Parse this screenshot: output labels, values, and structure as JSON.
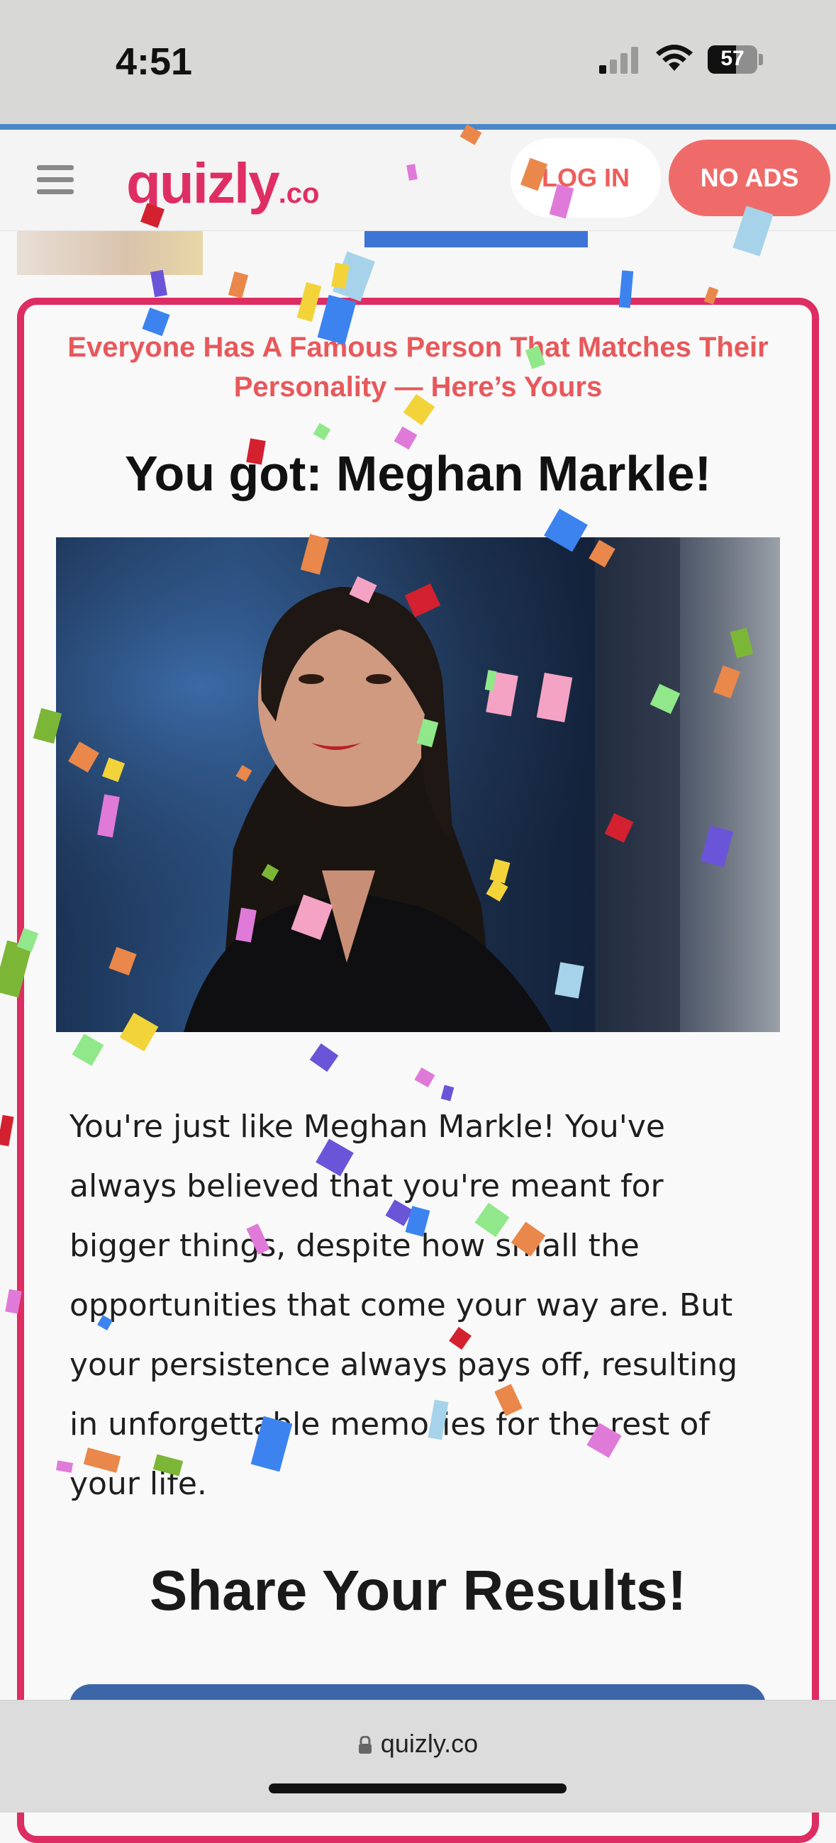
{
  "status_bar": {
    "time": "4:51",
    "battery": "57",
    "battery_level": 0.57
  },
  "header": {
    "logo_main": "quizly",
    "logo_tld": ".co",
    "login_label": "LOG IN",
    "no_ads_label": "NO ADS",
    "menu_icon": "hamburger-icon"
  },
  "result": {
    "quiz_title": "Everyone Has A Famous Person That Matches Their Personality — Here’s Yours",
    "heading": "You got: Meghan Markle!",
    "image_alt": "Meghan Markle portrait",
    "description": "You're just like Meghan Markle! You've always believed that you're meant for bigger things, despite how small the opportunities that come your way are. But your persistence always pays off, resulting in unforgettable memories for the rest of your life."
  },
  "share": {
    "heading": "Share Your Results!"
  },
  "browser": {
    "url": "quizly.co",
    "lock_icon": "lock-icon"
  },
  "colors": {
    "brand": "#df2e63",
    "accent_coral": "#ef6b69",
    "card_border": "#dd2d63",
    "share_button": "#3c66a8"
  }
}
